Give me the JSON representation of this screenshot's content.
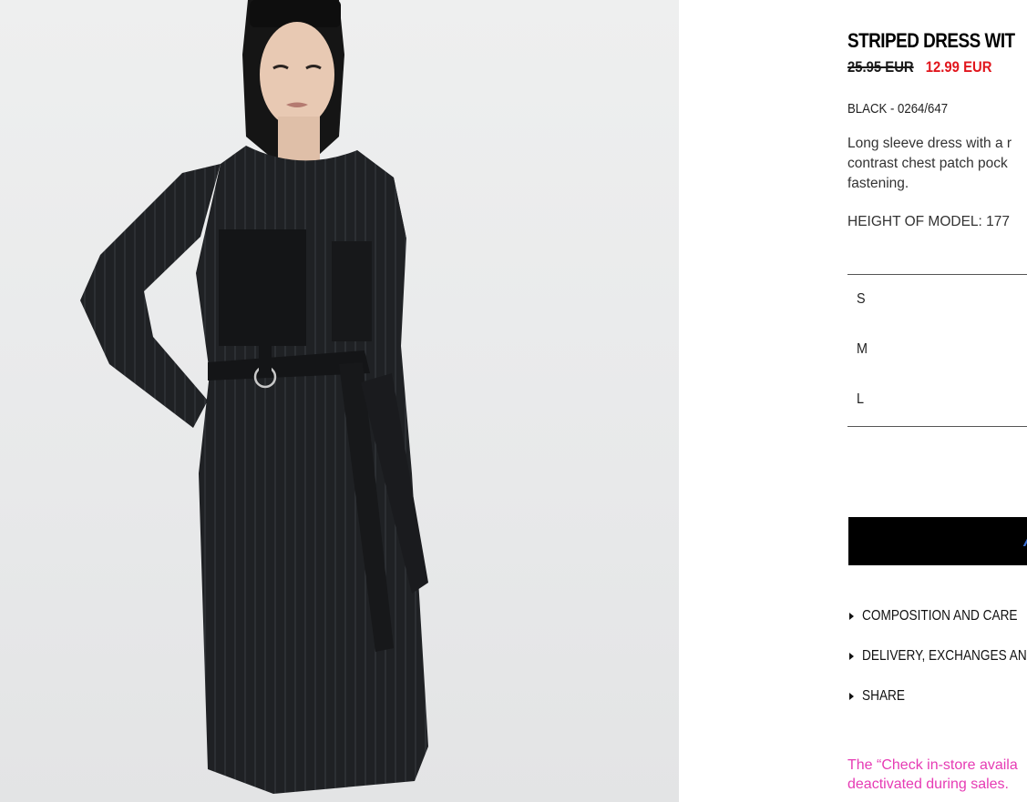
{
  "product": {
    "title": "STRIPED DRESS WIT",
    "price_old": "25.95 EUR",
    "price_new": "12.99 EUR",
    "color_ref": "BLACK - 0264/647",
    "description_lines": [
      "Long sleeve dress with a r",
      "contrast chest patch pock",
      "fastening."
    ],
    "model_height": "HEIGHT OF MODEL: 177"
  },
  "sizes": [
    "S",
    "M",
    "L"
  ],
  "add_button": {
    "label": "A"
  },
  "accordion": [
    {
      "label": "COMPOSITION AND CARE"
    },
    {
      "label": "DELIVERY, EXCHANGES AND"
    },
    {
      "label": "SHARE"
    }
  ],
  "note_lines": [
    "The “Check in-store availa",
    "deactivated during sales."
  ],
  "colors": {
    "sale_price": "#e1161d",
    "note_text": "#e63bb4",
    "button_bg": "#000000",
    "button_text": "#3b6fd4"
  },
  "icons": {
    "accordion": "caret-right-icon"
  }
}
